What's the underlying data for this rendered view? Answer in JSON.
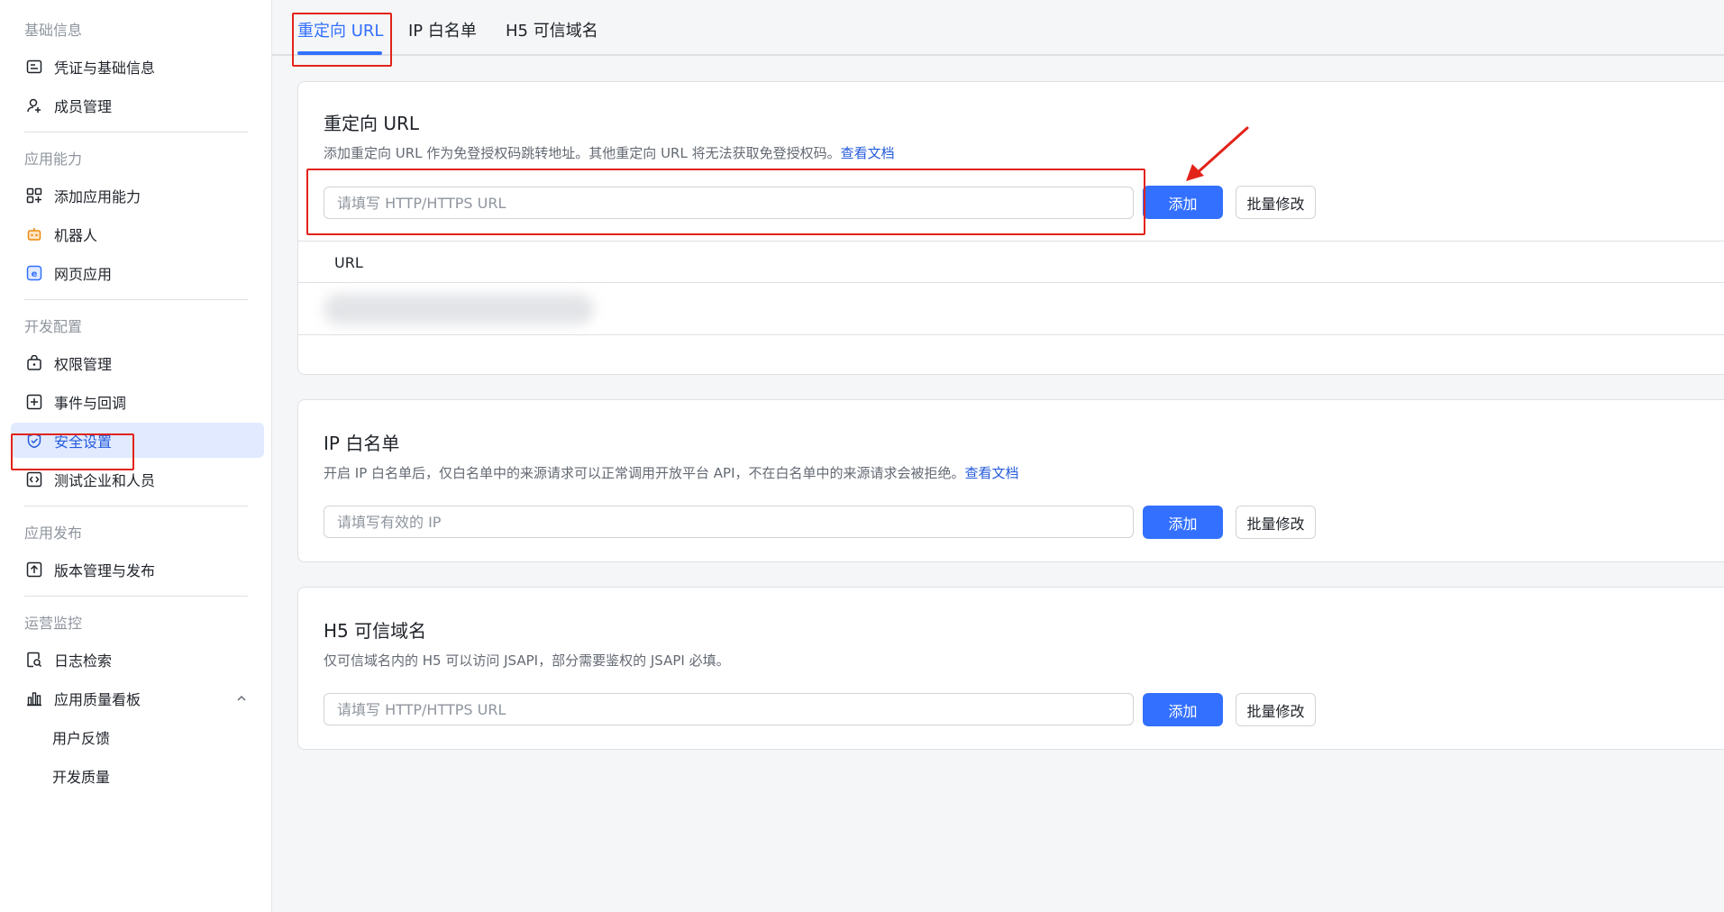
{
  "sidebar": {
    "groups": [
      {
        "title": "基础信息",
        "items": [
          "凭证与基础信息",
          "成员管理"
        ]
      },
      {
        "title": "应用能力",
        "items": [
          "添加应用能力",
          "机器人",
          "网页应用"
        ]
      },
      {
        "title": "开发配置",
        "items": [
          "权限管理",
          "事件与回调",
          "安全设置",
          "测试企业和人员"
        ]
      },
      {
        "title": "应用发布",
        "items": [
          "版本管理与发布"
        ]
      },
      {
        "title": "运营监控",
        "items": [
          "日志检索",
          "应用质量看板",
          "用户反馈",
          "开发质量"
        ]
      }
    ],
    "active_item": "安全设置"
  },
  "tabs": [
    "重定向 URL",
    "IP 白名单",
    "H5 可信域名"
  ],
  "active_tab": "重定向 URL",
  "redirect": {
    "title": "重定向 URL",
    "desc": "添加重定向 URL 作为免登授权码跳转地址。其他重定向 URL 将无法获取免登授权码。",
    "doc_link": "查看文档",
    "placeholder": "请填写 HTTP/HTTPS URL",
    "add_label": "添加",
    "batch_label": "批量修改",
    "table_header": "URL"
  },
  "ip": {
    "title": "IP 白名单",
    "desc": "开启 IP 白名单后，仅白名单中的来源请求可以正常调用开放平台 API，不在白名单中的来源请求会被拒绝。",
    "doc_link": "查看文档",
    "placeholder": "请填写有效的 IP",
    "add_label": "添加",
    "batch_label": "批量修改"
  },
  "h5": {
    "title": "H5 可信域名",
    "desc": "仅可信域名内的 H5 可以访问 JSAPI，部分需要鉴权的 JSAPI 必填。",
    "placeholder": "请填写 HTTP/HTTPS URL",
    "add_label": "添加",
    "batch_label": "批量修改"
  },
  "colors": {
    "primary": "#3370ff",
    "active_bg": "#e1eaff",
    "highlight": "#e2231a"
  }
}
